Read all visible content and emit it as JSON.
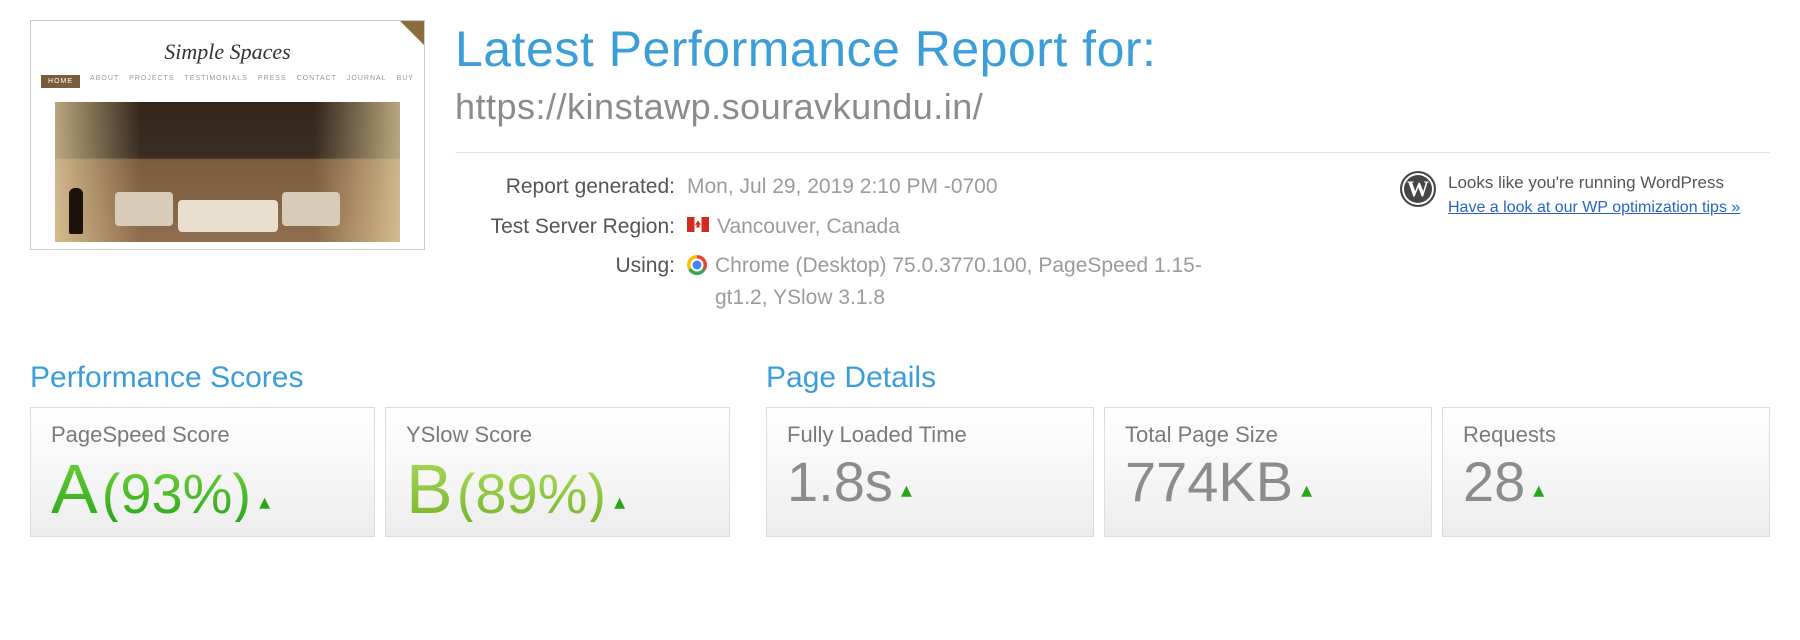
{
  "thumb": {
    "site_name": "Simple Spaces",
    "nav": [
      "HOME",
      "ABOUT",
      "PROJECTS",
      "TESTIMONIALS",
      "PRESS",
      "CONTACT",
      "JOURNAL",
      "BUY"
    ]
  },
  "header": {
    "title": "Latest Performance Report for:",
    "url": "https://kinstawp.souravkundu.in/"
  },
  "meta": {
    "generated_label": "Report generated:",
    "generated_value": "Mon, Jul 29, 2019 2:10 PM -0700",
    "region_label": "Test Server Region:",
    "region_value": "Vancouver, Canada",
    "using_label": "Using:",
    "using_value": "Chrome (Desktop) 75.0.3770.100, PageSpeed 1.15-gt1.2, YSlow 3.1.8"
  },
  "wp": {
    "text": "Looks like you're running WordPress",
    "link": "Have a look at our WP optimization tips »"
  },
  "scores": {
    "section_title": "Performance Scores",
    "pagespeed": {
      "label": "PageSpeed Score",
      "letter": "A",
      "pct": "(93%)"
    },
    "yslow": {
      "label": "YSlow Score",
      "letter": "B",
      "pct": "(89%)"
    }
  },
  "details": {
    "section_title": "Page Details",
    "load": {
      "label": "Fully Loaded Time",
      "value": "1.8s"
    },
    "size": {
      "label": "Total Page Size",
      "value": "774KB"
    },
    "requests": {
      "label": "Requests",
      "value": "28"
    }
  }
}
